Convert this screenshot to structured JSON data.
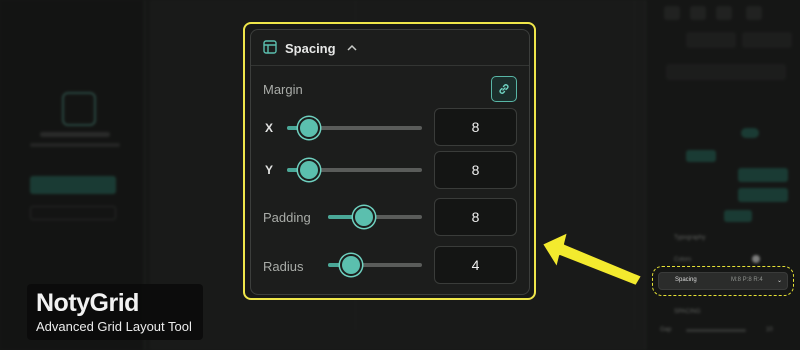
{
  "popup": {
    "title": "Spacing",
    "icon": "layout-icon",
    "collapse_icon": "chevron-up-icon",
    "margin_label": "Margin",
    "link_icon": "link-icon",
    "rows": [
      {
        "label": "X",
        "value": "8",
        "slider_fraction": 0.16
      },
      {
        "label": "Y",
        "value": "8",
        "slider_fraction": 0.16
      },
      {
        "label": "Padding",
        "value": "8",
        "slider_fraction": 0.38
      },
      {
        "label": "Radius",
        "value": "4",
        "slider_fraction": 0.24
      }
    ]
  },
  "right_panel": {
    "typography_label": "Typography",
    "colors_label": "Colors",
    "spacing_label": "Spacing",
    "spacing_summary": "M:8 P:8 R:4",
    "spacing_section_title": "SPACING",
    "gap_label": "Gap",
    "gap_value": "10"
  },
  "brand": {
    "name": "NotyGrid",
    "tagline": "Advanced Grid Layout Tool"
  },
  "colors": {
    "accent": "#5bbfae",
    "highlight": "#efe64a"
  }
}
